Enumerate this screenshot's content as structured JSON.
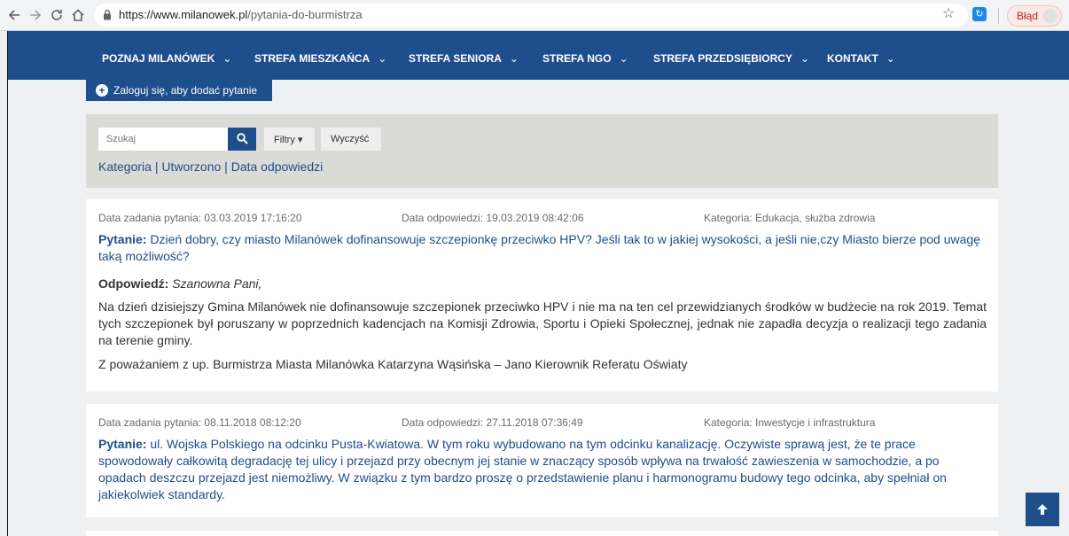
{
  "browser": {
    "url_host": "https://www.milanowek.pl",
    "url_path": "/pytania-do-burmistrza",
    "error_label": "Błąd"
  },
  "nav": {
    "items": [
      {
        "label": "POZNAJ MILANÓWEK",
        "caret": "⌄"
      },
      {
        "label": "STREFA MIESZKAŃCA",
        "caret": "⌄"
      },
      {
        "label": "STREFA SENIORA",
        "caret": "⌄"
      },
      {
        "label": "STREFA NGO",
        "caret": "⌄"
      },
      {
        "label": "STREFA PRZEDSIĘBIORCY",
        "caret": "⌄"
      },
      {
        "label": "KONTAKT",
        "caret": "⌄"
      }
    ]
  },
  "login_button": {
    "label": "Zaloguj się, aby dodać pytanie"
  },
  "search": {
    "placeholder": "Szukaj",
    "filters_label": "Filtry",
    "clear_label": "Wyczyść",
    "sort_category": "Kategoria",
    "sort_created": "Utworzono",
    "sort_answer_date": "Data odpowiedzi",
    "separator": " | "
  },
  "questions": [
    {
      "asked": "Data zadania pytania: 03.03.2019 17:16:20",
      "answered": "Data odpowiedzi: 19.03.2019 08:42:06",
      "category": "Kategoria: Edukacja, służba zdrowia",
      "question_label": "Pytanie:",
      "question": "Dzień dobry, czy miasto Milanówek dofinansowuje szczepionkę przeciwko HPV? Jeśli tak to w jakiej wysokości, a jeśli nie,czy Miasto bierze pod uwagę taką możliwość?",
      "answer_label": "Odpowiedź:",
      "answer_greeting": "Szanowna Pani,",
      "answer_body": "Na dzień dzisiejszy Gmina Milanówek nie dofinansowuje szczepionek przeciwko HPV i nie ma na ten cel przewidzianych środków w budżecie na rok 2019. Temat tych szczepionek był poruszany w poprzednich kadencjach na Komisji Zdrowia, Sportu i Opieki Społecznej, jednak nie zapadła decyzja o realizacji tego zadania na terenie gminy.",
      "answer_signature": "Z poważaniem z up. Burmistrza Miasta Milanówka Katarzyna Wąsińska – Jano Kierownik Referatu Oświaty"
    },
    {
      "asked": "Data zadania pytania: 08.11.2018 08:12:20",
      "answered": "Data odpowiedzi: 27.11.2018 07:36:49",
      "category": "Kategoria: Inwestycje i infrastruktura",
      "question_label": "Pytanie:",
      "question": "ul. Wojska Polskiego na odcinku Pusta-Kwiatowa. W tym roku wybudowano na tym odcinku kanalizację. Oczywiste sprawą jest, że te prace spowodowały całkowitą degradację tej ulicy i przejazd przy obecnym jej stanie w znaczący sposób wpływa na trwałość zawieszenia w samochodzie, a po opadach deszczu przejazd jest niemożliwy. W związku z tym bardzo proszę o przedstawienie planu i harmonogramu budowy tego odcinka, aby spełniał on jakiekolwiek standardy."
    }
  ],
  "colors": {
    "brand": "#1e4e8c",
    "page_bg": "#eef0f1",
    "panel_bg": "#dadbd6"
  },
  "icons": [
    "back-arrow-icon",
    "forward-arrow-icon",
    "reload-icon",
    "home-icon",
    "lock-icon",
    "star-icon",
    "extension-icon",
    "plus-circle-icon",
    "search-icon",
    "caret-down-icon",
    "arrow-up-icon"
  ]
}
